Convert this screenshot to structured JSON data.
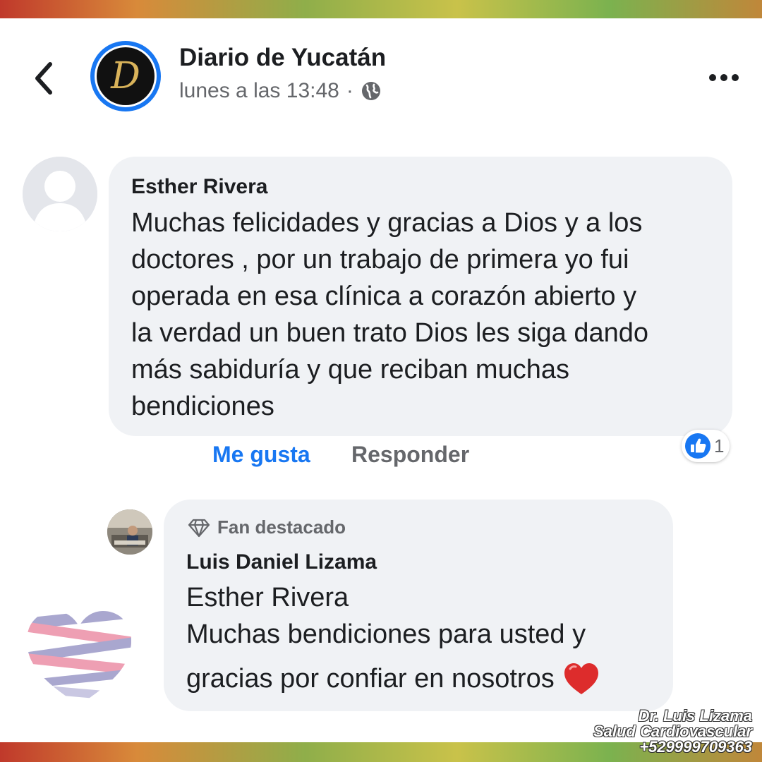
{
  "header": {
    "page_name": "Diario de Yucatán",
    "timestamp": "lunes a las 13:48",
    "separator": "·",
    "logo_letter": "D",
    "back_icon": "chevron-left-icon",
    "privacy_icon": "globe-icon",
    "more_icon": "more-horizontal-icon"
  },
  "comment": {
    "author": "Esther Rivera",
    "lines": [
      "Muchas felicidades y gracias a Dios y a los",
      "doctores , por un trabajo de primera yo fui",
      "operada en esa clínica a corazón abierto y",
      "la verdad un buen trato Dios les siga dando",
      "más sabiduría y que reciban muchas",
      "bendiciones"
    ],
    "actions": {
      "like": "Me gusta",
      "reply": "Responder"
    },
    "reaction": {
      "icon": "thumbs-up-icon",
      "count": "1"
    }
  },
  "reply": {
    "badge": "Fan destacado",
    "badge_icon": "diamond-icon",
    "author": "Luis Daniel Lizama",
    "line1": "Esther Rivera",
    "line2": "Muchas bendiciones para usted y",
    "line3": "gracias por confiar en nosotros",
    "emoji": "❤️"
  },
  "watermark": {
    "name": "Dr. Luis Lizama",
    "specialty": "Salud Cardiovascular",
    "phone": "+529999709363"
  },
  "colors": {
    "accent": "#1877f2",
    "bubble": "#f0f2f5",
    "text": "#1c1e21",
    "muted": "#65676b"
  }
}
